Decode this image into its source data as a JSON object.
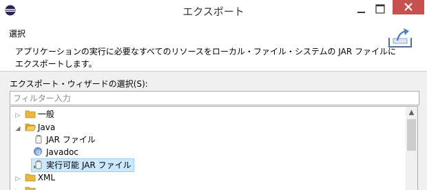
{
  "window": {
    "title": "エクスポート"
  },
  "banner": {
    "title": "選択",
    "description": "アプリケーションの実行に必要なすべてのリソースをローカル・ファイル・システムの JAR ファイルにエクスポートします。"
  },
  "wizard": {
    "label": "エクスポート・ウィザードの選択(S):",
    "filter_placeholder": "フィルター入力"
  },
  "tree": {
    "general": "一般",
    "java": "Java",
    "jar": "JAR ファイル",
    "javadoc": "Javadoc",
    "runnable": "実行可能 JAR ファイル",
    "xml": "XML"
  },
  "colors": {
    "close": "#c75050",
    "selection": "#cce8ff",
    "folder": "#e8b73c"
  }
}
